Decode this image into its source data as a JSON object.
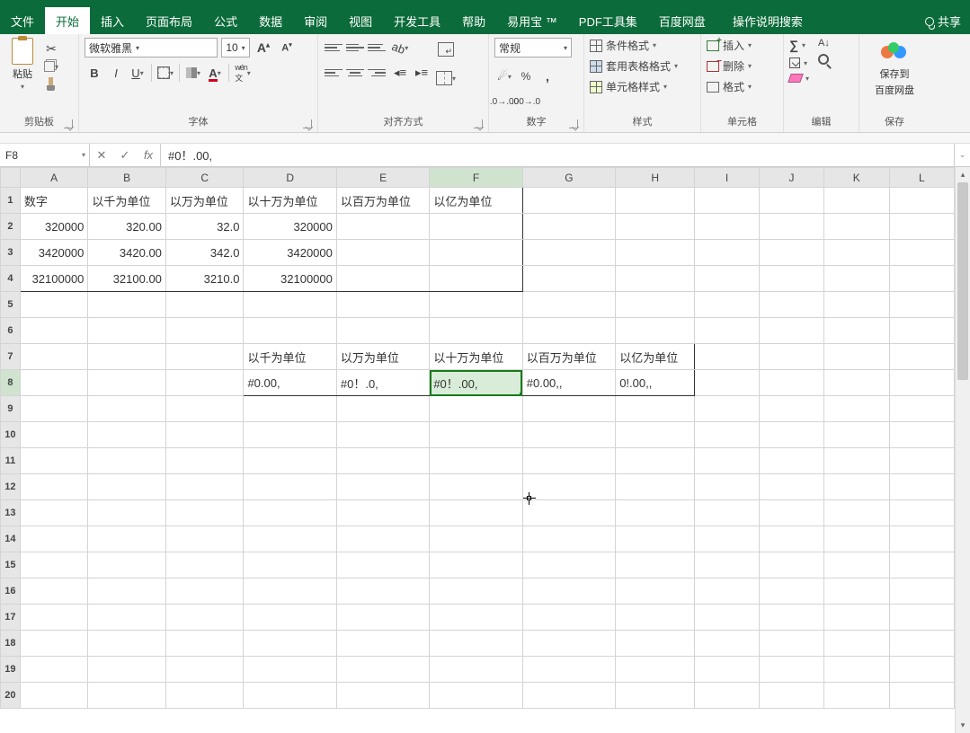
{
  "tabs": {
    "file": "文件",
    "home": "开始",
    "insert": "插入",
    "layout": "页面布局",
    "formulas": "公式",
    "data": "数据",
    "review": "审阅",
    "view": "视图",
    "dev": "开发工具",
    "help": "帮助",
    "yyb": "易用宝 ™",
    "pdf": "PDF工具集",
    "baidu": "百度网盘",
    "tell": "操作说明搜索",
    "share": "共享"
  },
  "ribbon": {
    "clipboard": {
      "label": "剪贴板",
      "paste": "粘贴"
    },
    "font": {
      "label": "字体",
      "name": "微软雅黑",
      "size": "10",
      "bold": "B",
      "italic": "I",
      "underline": "U"
    },
    "align": {
      "label": "对齐方式"
    },
    "number": {
      "label": "数字",
      "format": "常规"
    },
    "styles": {
      "label": "样式",
      "cond": "条件格式",
      "tbl": "套用表格格式",
      "cell": "单元格样式"
    },
    "cells": {
      "label": "单元格",
      "insert": "插入",
      "delete": "删除",
      "format": "格式"
    },
    "editing": {
      "label": "编辑"
    },
    "save": {
      "label": "保存",
      "btn1": "保存到",
      "btn2": "百度网盘"
    }
  },
  "fbar": {
    "name": "F8",
    "formula": "#0！.00,"
  },
  "columns": [
    "A",
    "B",
    "C",
    "D",
    "E",
    "F",
    "G",
    "H",
    "I",
    "J",
    "K",
    "L"
  ],
  "sheet": {
    "r1": {
      "A": "数字",
      "B": "以千为单位",
      "C": "以万为单位",
      "D": "以十万为单位",
      "E": "以百万为单位",
      "F": "以亿为单位"
    },
    "r2": {
      "A": "320000",
      "B": "320.00",
      "C": "32.0",
      "D": "320000"
    },
    "r3": {
      "A": "3420000",
      "B": "3420.00",
      "C": "342.0",
      "D": "3420000"
    },
    "r4": {
      "A": "32100000",
      "B": "32100.00",
      "C": "3210.0",
      "D": "32100000"
    },
    "r7": {
      "D": "以千为单位",
      "E": "以万为单位",
      "F": "以十万为单位",
      "G": "以百万为单位",
      "H": "以亿为单位"
    },
    "r8": {
      "D": "#0.00,",
      "E": "#0！.0,",
      "F": "#0！.00,",
      "G": "#0.00,,",
      "H": "0!.00,,"
    }
  },
  "selected": {
    "cell": "F8",
    "col": "F",
    "row": "8"
  }
}
